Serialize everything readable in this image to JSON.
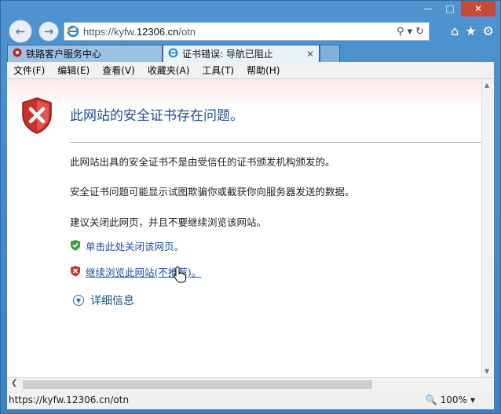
{
  "browser": {
    "address_url_prefix": "https://kyfw.",
    "address_url_domain": "12306.cn",
    "address_url_path": "/otn",
    "tabs": [
      {
        "label": "铁路客户服务中心"
      },
      {
        "label": "证书错误: 导航已阻止"
      }
    ],
    "menu": [
      "文件(F)",
      "编辑(E)",
      "查看(V)",
      "收藏夹(A)",
      "工具(T)",
      "帮助(H)"
    ]
  },
  "error_page": {
    "title": "此网站的安全证书存在问题。",
    "paragraph1": "此网站出具的安全证书不是由受信任的证书颁发机构颁发的。",
    "paragraph2": "安全证书问题可能显示试图欺骗你或截获你向服务器发送的数据。",
    "paragraph3": "建议关闭此网页，并且不要继续浏览该网站。",
    "link_close": "单击此处关闭该网页。",
    "link_continue": "继续浏览此网站(不推荐)。",
    "more_info": "详细信息"
  },
  "status_bar": {
    "url": "https://kyfw.12306.cn/otn",
    "zoom": "100%"
  },
  "colors": {
    "link": "#1a4ea0",
    "title": "#1b4f94",
    "chrome": "#4a8fcd"
  }
}
